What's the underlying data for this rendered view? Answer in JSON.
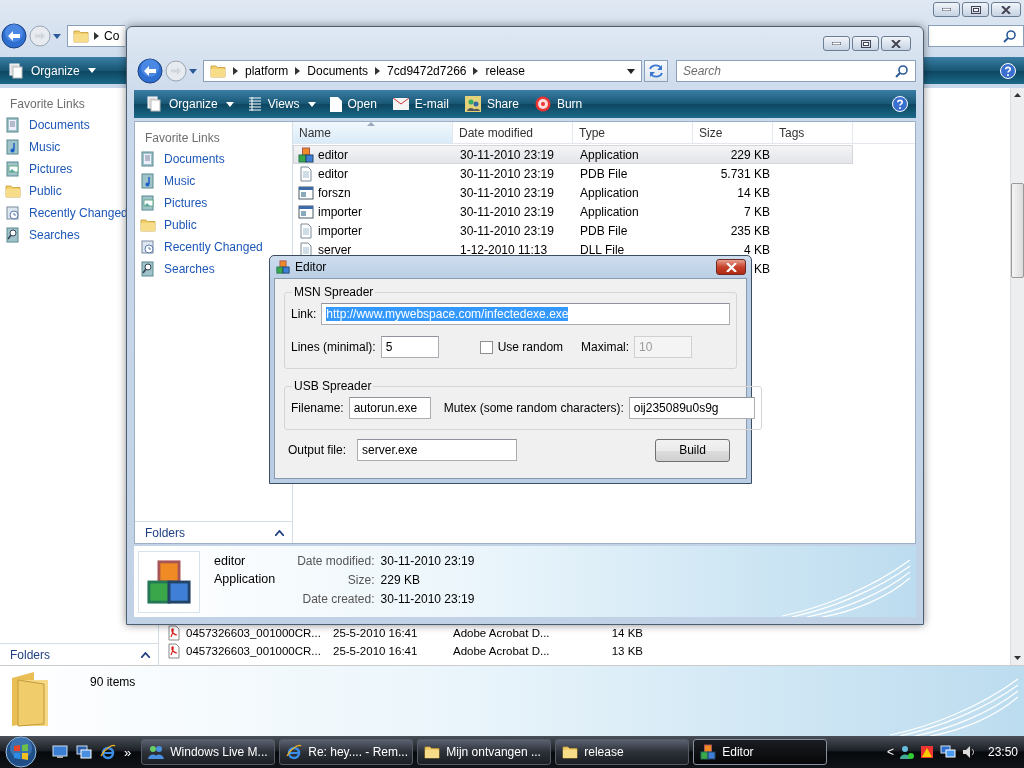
{
  "back_window": {
    "address": [
      "Co"
    ],
    "toolbar": [
      {
        "label": "Organize",
        "has_menu": true
      }
    ],
    "favorite_links_title": "Favorite Links",
    "favorite_links": [
      "Documents",
      "Music",
      "Pictures",
      "Public",
      "Recently Changed",
      "Searches"
    ],
    "folders_label": "Folders",
    "files": [
      {
        "kind": "pdf",
        "name": "0457326603_001000CR...",
        "date": "25-5-2010 16:41",
        "type": "Adobe Acrobat D...",
        "size": "14 KB",
        "selected": false
      },
      {
        "kind": "pdf",
        "name": "0457326603_001000CR...",
        "date": "25-5-2010 16:41",
        "type": "Adobe Acrobat D...",
        "size": "13 KB",
        "selected": false
      }
    ],
    "status": "90 items"
  },
  "front_window": {
    "address": [
      "platform",
      "Documents",
      "7cd9472d7266",
      "release"
    ],
    "search": {
      "placeholder": "Search"
    },
    "toolbar": [
      {
        "label": "Organize",
        "has_menu": true
      },
      {
        "label": "Views",
        "has_menu": true
      },
      {
        "label": "Open",
        "has_menu": false
      },
      {
        "label": "E-mail",
        "has_menu": false
      },
      {
        "label": "Share",
        "has_menu": false
      },
      {
        "label": "Burn",
        "has_menu": false
      }
    ],
    "favorite_links_title": "Favorite Links",
    "favorite_links": [
      "Documents",
      "Music",
      "Pictures",
      "Public",
      "Recently Changed",
      "Searches"
    ],
    "folders_label": "Folders",
    "columns": [
      {
        "label": "Name",
        "sorted": true
      },
      {
        "label": "Date modified",
        "sorted": false
      },
      {
        "label": "Type",
        "sorted": false
      },
      {
        "label": "Size",
        "sorted": false
      },
      {
        "label": "Tags",
        "sorted": false
      }
    ],
    "files": [
      {
        "kind": "mfc_app",
        "name": "editor",
        "date": "30-11-2010 23:19",
        "type": "Application",
        "size": "229 KB",
        "selected": true
      },
      {
        "kind": "pdb",
        "name": "editor",
        "date": "30-11-2010 23:19",
        "type": "PDB File",
        "size": "5.731 KB",
        "selected": false
      },
      {
        "kind": "app",
        "name": "forszn",
        "date": "30-11-2010 23:19",
        "type": "Application",
        "size": "14 KB",
        "selected": false
      },
      {
        "kind": "app",
        "name": "importer",
        "date": "30-11-2010 23:19",
        "type": "Application",
        "size": "7 KB",
        "selected": false
      },
      {
        "kind": "pdb",
        "name": "importer",
        "date": "30-11-2010 23:19",
        "type": "PDB File",
        "size": "235 KB",
        "selected": false
      },
      {
        "kind": "dll",
        "name": "server",
        "date": "1-12-2010 11:13",
        "type": "DLL File",
        "size": "4 KB",
        "selected": false
      },
      {
        "size": "KB",
        "selected": false
      }
    ],
    "details": {
      "name": "editor",
      "type": "Application",
      "fields": [
        {
          "label": "Date modified:",
          "value": "30-11-2010 23:19"
        },
        {
          "label": "Size:",
          "value": "229 KB"
        },
        {
          "label": "Date created:",
          "value": "30-11-2010 23:19"
        }
      ]
    }
  },
  "dialog": {
    "title": "Editor",
    "msn_group": {
      "title": "MSN Spreader",
      "link": {
        "label": "Link:",
        "value": "http://www.mywebspace.com/infectedexe.exe",
        "selected": true
      },
      "lines": {
        "label": "Lines (minimal):",
        "value": "5"
      },
      "use_random": {
        "label": "Use random",
        "checked": false
      },
      "maximal": {
        "label": "Maximal:",
        "value": "10",
        "disabled": true
      }
    },
    "usb_group": {
      "title": "USB Spreader",
      "filename": {
        "label": "Filename:",
        "value": "autorun.exe"
      },
      "mutex": {
        "label": "Mutex (some random characters):",
        "value": "oij235089u0s9g"
      }
    },
    "output": {
      "label": "Output file:",
      "value": "server.exe"
    },
    "build_button": "Build"
  },
  "taskbar": {
    "quick_launch_more": "»",
    "buttons": [
      {
        "label": "Windows Live M...",
        "selected": false
      },
      {
        "label": "Re: hey.... - Rem...",
        "selected": false
      },
      {
        "label": "Mijn ontvangen ...",
        "selected": false
      },
      {
        "label": "release",
        "selected": false
      },
      {
        "label": "Editor",
        "selected": true
      }
    ],
    "tray_expand": "<",
    "clock": "23:50"
  }
}
